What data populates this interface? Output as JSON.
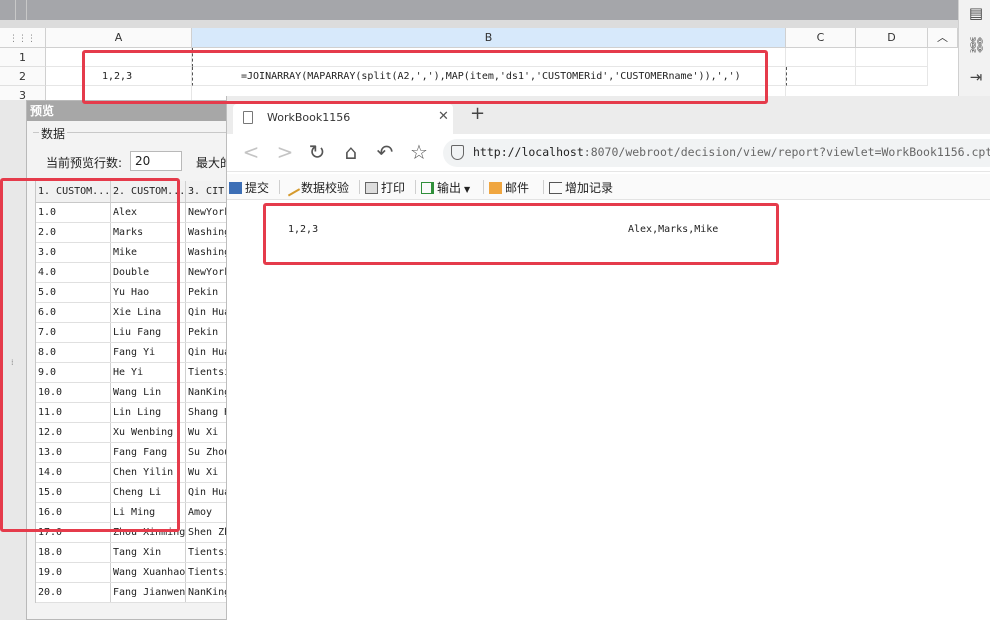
{
  "sheet": {
    "columns": [
      "A",
      "B",
      "C",
      "D"
    ],
    "row_numbers": [
      "1",
      "2",
      "3"
    ],
    "a2_value": "1,2,3",
    "b2_formula": "=JOINARRAY(MAPARRAY(split(A2,','),MAP(item,'ds1','CUSTOMERid','CUSTOMERname')),',')"
  },
  "preview": {
    "title": "预览",
    "section_label": "数据",
    "rows_label": "当前预览行数:",
    "rows_value": "20",
    "max_label": "最大的",
    "headers": [
      "1. CUSTOM...",
      "2. CUSTOM...",
      "3. CIT"
    ],
    "rows": [
      [
        "1.0",
        "Alex",
        "NewYork"
      ],
      [
        "2.0",
        "Marks",
        "Washington"
      ],
      [
        "3.0",
        "Mike",
        "Washington"
      ],
      [
        "4.0",
        "Double",
        "NewYork"
      ],
      [
        "5.0",
        "Yu Hao",
        "Pekin"
      ],
      [
        "6.0",
        "Xie Lina",
        "Qin Huang"
      ],
      [
        "7.0",
        "Liu Fang",
        "Pekin"
      ],
      [
        "8.0",
        "Fang Yi",
        "Qin Huang"
      ],
      [
        "9.0",
        "He Yi",
        "Tientsin"
      ],
      [
        "10.0",
        "Wang Lin",
        "NanKing"
      ],
      [
        "11.0",
        "Lin Ling",
        "Shang Hai"
      ],
      [
        "12.0",
        "Xu Wenbing",
        "Wu Xi"
      ],
      [
        "13.0",
        "Fang Fang",
        "Su Zhou"
      ],
      [
        "14.0",
        "Chen Yilin",
        "Wu Xi"
      ],
      [
        "15.0",
        "Cheng Li",
        "Qin Huang"
      ],
      [
        "16.0",
        "Li Ming",
        "Amoy"
      ],
      [
        "17.0",
        "Zhou Xinming",
        "Shen Zhen"
      ],
      [
        "18.0",
        "Tang Xin",
        "Tientsin"
      ],
      [
        "19.0",
        "Wang Xuanhao",
        "Tientsin"
      ],
      [
        "20.0",
        "Fang Jianwen",
        "NanKing"
      ]
    ]
  },
  "browser": {
    "tab_title": "WorkBook1156",
    "url_host": "http://localhost",
    "url_rest": ":8070/webroot/decision/view/report?viewlet=WorkBook1156.cpt",
    "toolbar": {
      "submit": "提交",
      "validate": "数据校验",
      "print": "打印",
      "export": "输出",
      "email": "邮件",
      "add_record": "增加记录"
    },
    "report": {
      "a1": "1,2,3",
      "b1": "Alex,Marks,Mike"
    }
  },
  "colors": {
    "highlight": "#e53b4b",
    "toolbar_gray": "#a5a6aa",
    "dialog_title": "#a7a7a7"
  }
}
